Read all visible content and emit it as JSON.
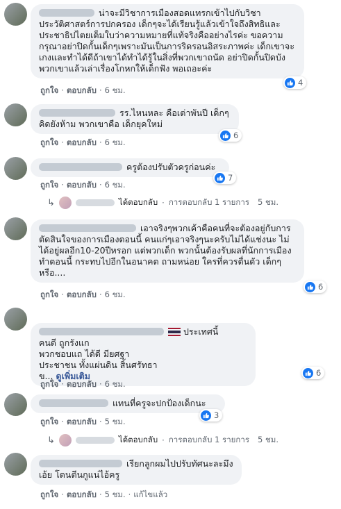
{
  "actions": {
    "like": "ถูกใจ",
    "reply": "ตอบกลับ",
    "edit": "แก้ไขแล้ว",
    "sep": "·"
  },
  "comments": [
    {
      "text": "น่าจะมีวิชาการเมืองสอดแทรกเข้าไปกับวิชาประวัติศาสตร์การปกครอง เด็กๆจะได้เรียนรู้แล้วเข้าใจถึงสิทธิและประชาธิปไตยเต็มใบว่าความหมายที่แท้จริงคืออย่างไรค่ะ ขอความกรุณาอย่าปิดกั้นเด็กๆเพราะมันเป็นการริดรอนอิสระภาพค่ะ เด็กเขาจะเกงและทำได้ดีถ้าเขาได้ทำได้รู้ในสิ่งที่พวกเขาถนัด อย่าปิดกั้นปิดบังพวกเขาแล้วเล่าเรื่องโกหกให้เด็กฟัง พอเถอะค่ะ",
      "time": "6 ชม.",
      "reactions": "4"
    },
    {
      "text": "รร.ไหนหละ คือเต่าพันปี เด็กๆคิดยังห้าม พวกเขาคือ เด็กยุคใหม่",
      "time": "6 ชม.",
      "reactions": "6"
    },
    {
      "text": "ครูต้องปรับตัวครูก่อนค่ะ",
      "time": "6 ชม.",
      "reactions": "7",
      "replies": {
        "action": "ได้ตอบกลับ",
        "count": "การตอบกลับ 1 รายการ",
        "time": "5 ชม."
      }
    },
    {
      "text": "เอาจริงๆพวกเค้าคือคนที่จะต้องอยู่กับการตัดสินใจของการเมืองตอนนี้ คนแก่ๆเอาจริงๆนะครับไม่ได้แช่งนะ ไม่ได้อยู่ผลอีก10-20ปีหรอก แต่พวกเด็ก พวกนั้นต้องรับผลที่นักการเมืองทำตอนนี้ กระทบไปอีกในอนาคต ถามหน่อย ใครที่ควรตื่นตัว เด็กๆหรือ....",
      "time": "6 ชม.",
      "reactions": "6"
    },
    {
      "lines": [
        "ประเทศนี้",
        "คนดี ถูกรังแก",
        "พวกชอบแถ ได้ดี มียศฐา",
        "ประชาชน ทั้งแผ่นดิน สิ้นศรัทธา",
        "ข...",
        "ดูเพิ่มเติม"
      ],
      "time": "6 ชม.",
      "reactions": "6"
    },
    {
      "text": "แทนที่ครูจะปกป้องเด็กนะ",
      "time": "5 ชม.",
      "reactions": "3",
      "replies": {
        "action": "ได้ตอบกลับ",
        "count": "การตอบกลับ 1 รายการ",
        "time": "5 ชม."
      }
    },
    {
      "text": "เรียกลูกผมไปปรับทัศนะละมึงเอ้ย โดนตีนกูแน่ไอ้ครู",
      "time": "5 ชม."
    }
  ],
  "colors": {
    "like": "#1877f2",
    "bubble": "#f0f2f5",
    "link": "#385898"
  }
}
